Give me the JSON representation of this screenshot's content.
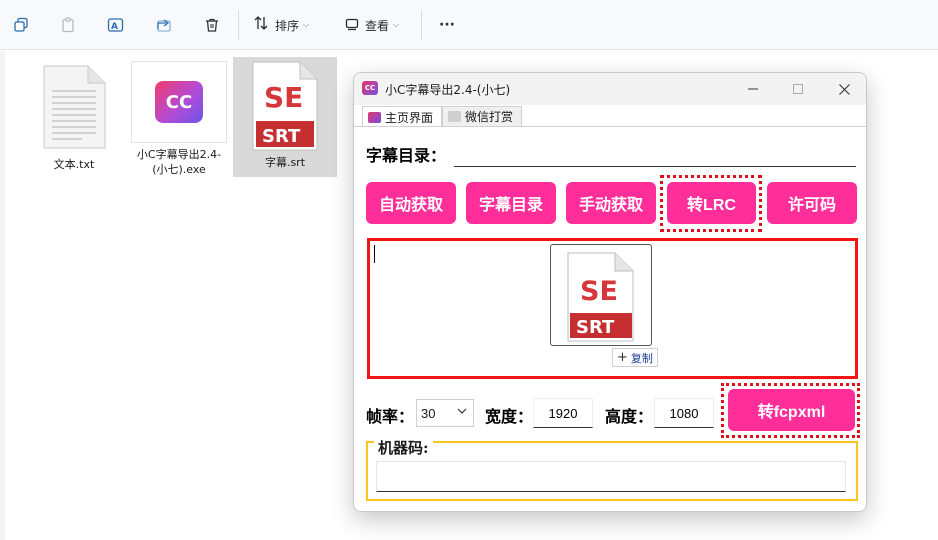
{
  "explorer": {
    "toolbar": {
      "sort_label": "排序",
      "view_label": "查看",
      "more_label": "···"
    },
    "files": [
      {
        "name": "文本.txt",
        "icon": "text-file-icon"
      },
      {
        "name": "小C字幕导出2.4-(小七).exe",
        "icon": "app-exe-icon"
      },
      {
        "name": "字幕.srt",
        "icon": "srt-file-icon"
      }
    ]
  },
  "window": {
    "title": "小C字幕导出2.4-(小七)",
    "app_icon_text": "CC",
    "tabs": [
      {
        "label": "主页界面",
        "active": true
      },
      {
        "label": "微信打赏",
        "active": false
      }
    ],
    "subtitle_dir": {
      "label": "字幕目录：",
      "value": ""
    },
    "buttons": {
      "auto_fetch": "自动获取",
      "subtitle_dir": "字幕目录",
      "manual_fetch": "手动获取",
      "to_lrc": "转LRC",
      "license": "许可码",
      "to_fcpxml": "转fcpxml"
    },
    "drop_area": {
      "drag_file_icon_text_top": "SE",
      "drag_file_icon_text_bottom": "SRT",
      "copy_tip": "复制"
    },
    "frame_rate": {
      "label": "帧率：",
      "value": "30"
    },
    "width": {
      "label": "宽度：",
      "value": "1920"
    },
    "height": {
      "label": "高度：",
      "value": "1080"
    },
    "machine_code": {
      "label": "机器码:",
      "value": ""
    }
  },
  "colors": {
    "button_pink": "#ff2e98",
    "highlight_red": "#e0101a",
    "group_yellow": "#ffc61a"
  }
}
